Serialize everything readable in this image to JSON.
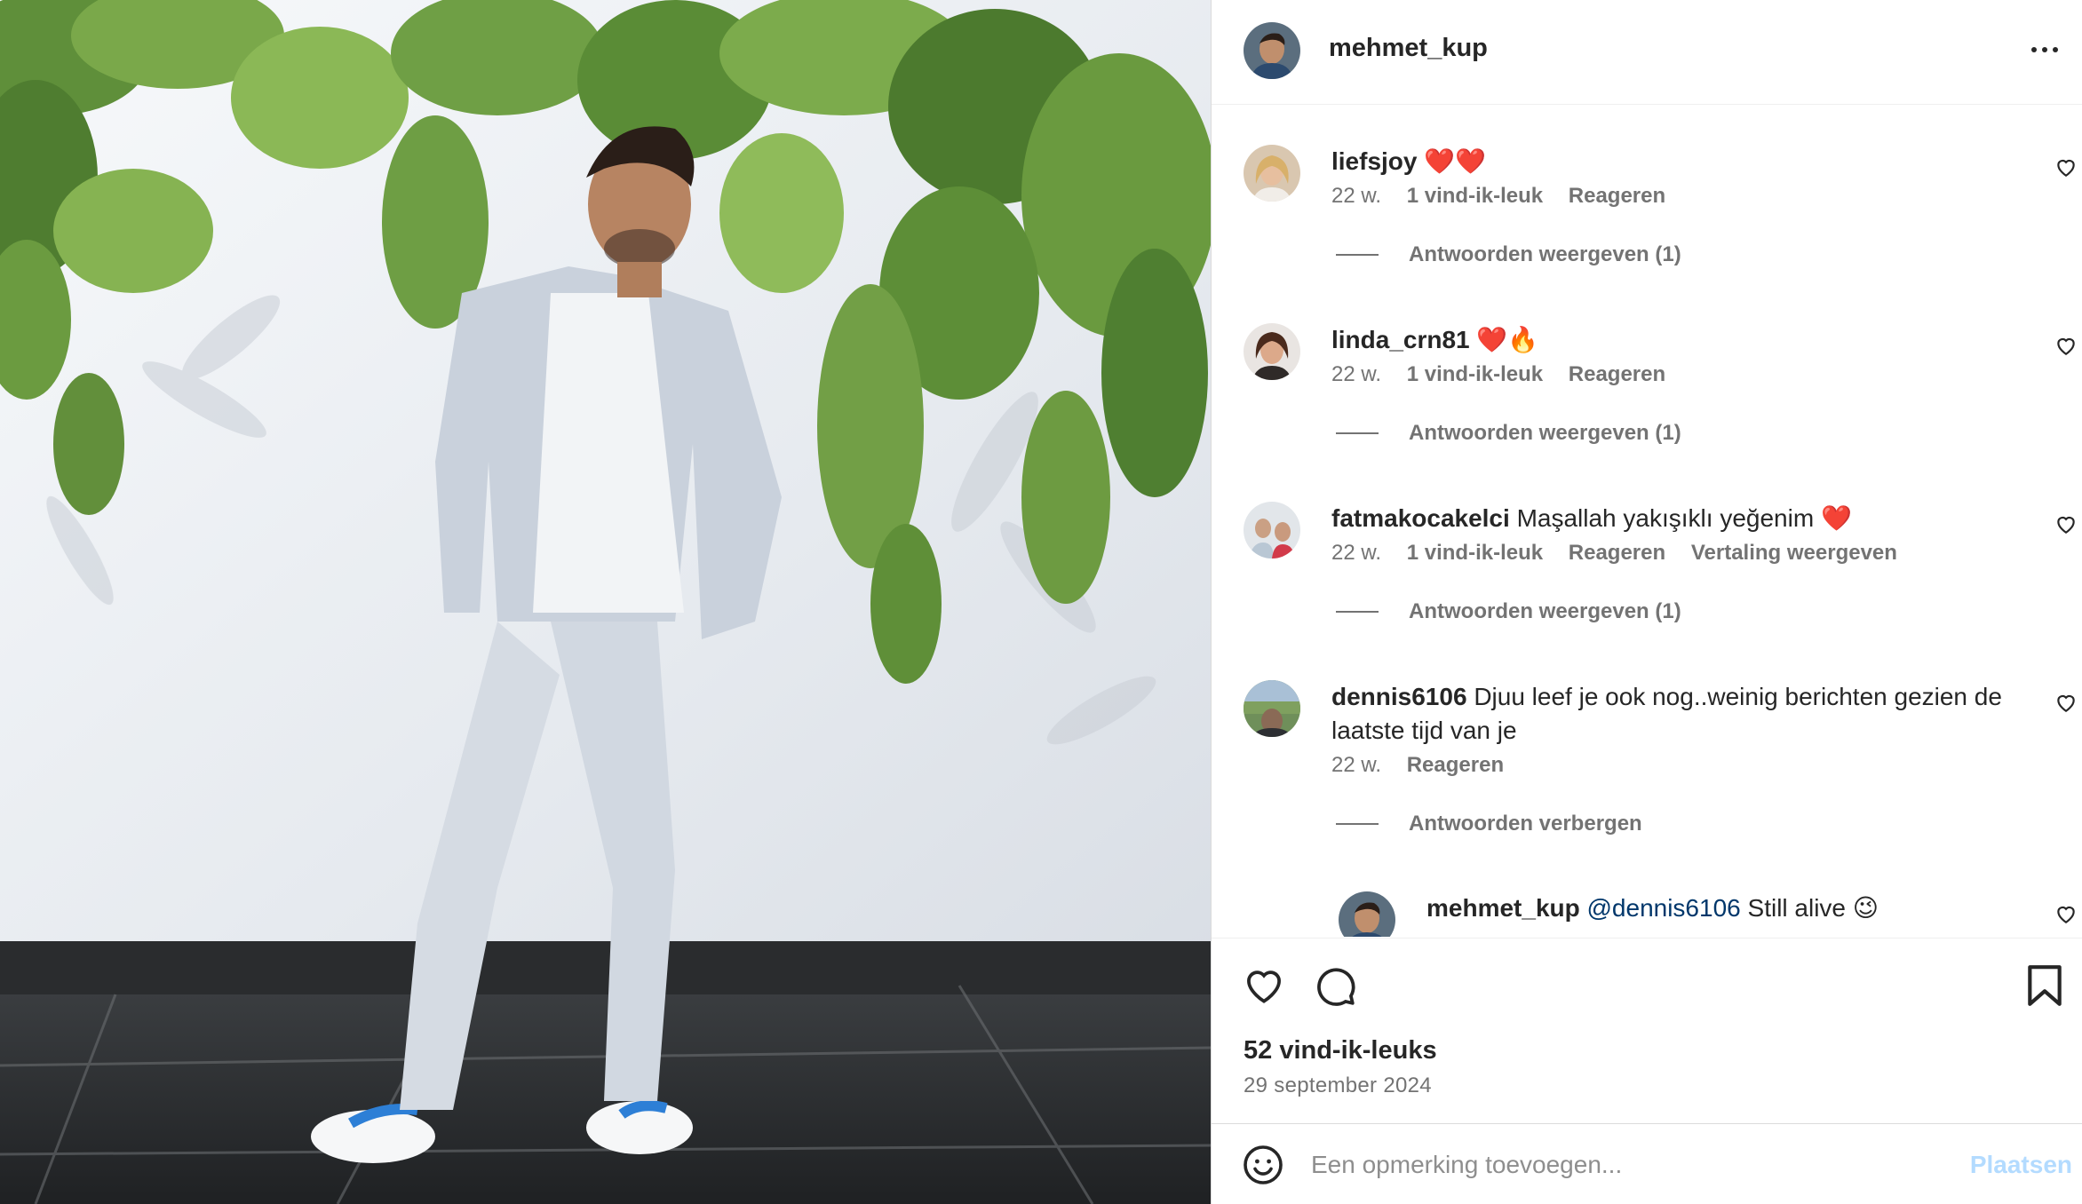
{
  "post": {
    "author": "mehmet_kup",
    "likes": "52 vind-ik-leuks",
    "date": "29 september 2024"
  },
  "comments": [
    {
      "user": "liefsjoy",
      "text": "",
      "emoji": "❤️❤️",
      "age": "22 w.",
      "likes": "1 vind-ik-leuk",
      "reply": "Reageren",
      "translate": "",
      "replies_label": "Antwoorden weergeven (1)"
    },
    {
      "user": "linda_crn81",
      "text": "",
      "emoji": "❤️🔥",
      "age": "22 w.",
      "likes": "1 vind-ik-leuk",
      "reply": "Reageren",
      "translate": "",
      "replies_label": "Antwoorden weergeven (1)"
    },
    {
      "user": "fatmakocakelci",
      "text": "Maşallah yakışıklı yeğenim",
      "emoji": "❤️",
      "age": "22 w.",
      "likes": "1 vind-ik-leuk",
      "reply": "Reageren",
      "translate": "Vertaling weergeven",
      "replies_label": "Antwoorden weergeven (1)"
    },
    {
      "user": "dennis6106",
      "text": "Djuu leef je ook nog..weinig berichten gezien de laatste tijd van je",
      "emoji": "",
      "age": "22 w.",
      "likes": "",
      "reply": "Reageren",
      "translate": "",
      "replies_label": "Antwoorden verbergen"
    }
  ],
  "reply": {
    "user": "mehmet_kup",
    "mention": "@dennis6106",
    "text": "Still alive",
    "emoji": "😉"
  },
  "comment_input": {
    "placeholder": "Een opmerking toevoegen...",
    "submit_label": "Plaatsen"
  },
  "icons": {
    "more": "more-icon",
    "like": "heart-icon",
    "comment": "comment-icon",
    "save": "bookmark-icon",
    "emoji": "emoji-icon"
  },
  "colors": {
    "text": "#262626",
    "secondary": "#737373",
    "mention": "#00376b",
    "post_button_disabled": "#b3dbff",
    "heart_emoji": "#e0245e"
  }
}
